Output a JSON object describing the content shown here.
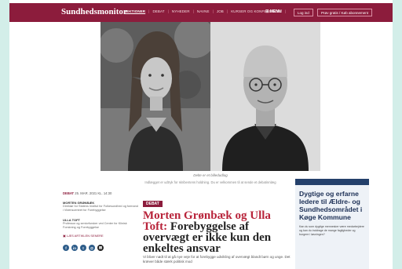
{
  "header": {
    "logo": "Sundhedsmonitor",
    "nav": [
      "SEKTIONER",
      "DEBAT",
      "NYHEDER",
      "NAVNE",
      "JOB",
      "KURSER OG KONFERENCER"
    ],
    "menu": "☰ MENU",
    "login": "Log ind",
    "subscribe": "Prøv gratis / Køb abonnement"
  },
  "photo": {
    "caption": "Delte er et billedudlag",
    "credit": "Indlægget er udtryk for skribentens holdning. Du er velkommen til at sende et debatinnlæg"
  },
  "meta": {
    "label": "DEBAT",
    "date": "25. MAR. 2021 KL. 14:30",
    "author1": "MORTEN GRØNBÆK",
    "role1": "Direktør for Statens Institut for Folkesundhed og formand i Videnscentret for Forebyggelse",
    "author2": "ULLA TOFT",
    "role2": "Professor og seniorforsker ved Center for Klinisk Forskning og Forebyggelse",
    "read_link": "LÆS ARTIKLEN SENERE"
  },
  "article": {
    "tag": "DEBAT",
    "headline_red": "Morten Grønbæk og Ulla Toft:",
    "headline_black": "Forebyggelse af overvægt er ikke kun den enkeltes ansvar",
    "lead": "Vi bliver nødt til at gå nye veje for at forebygge udvikling af overvægt blandt børn og unge. Det kræver både stærk politisk mod"
  },
  "ad": {
    "title": "Dygtige og erfarne ledere til Ældre- og Sundhedsområdet i Køge Kommune",
    "text": "Kan du som dygtige mennesker være medarbejdere og kan du inddrage de mange fagligheder og borgere i løsningen?"
  }
}
